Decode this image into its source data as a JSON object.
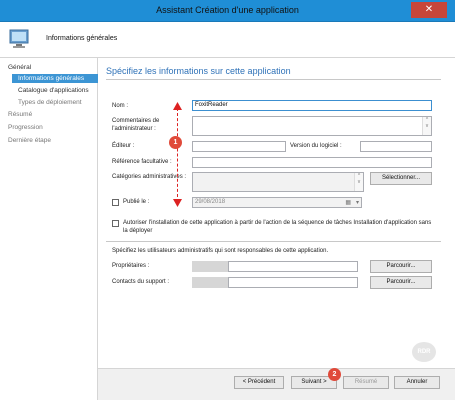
{
  "window": {
    "title": "Assistant Création d'une application",
    "close_label": "✕"
  },
  "header": {
    "title": "Informations générales"
  },
  "sidebar": {
    "items": [
      {
        "label": "Général"
      },
      {
        "label": "Informations générales"
      },
      {
        "label": "Catalogue d'applications"
      },
      {
        "label": "Types de déploiement"
      },
      {
        "label": "Résumé"
      },
      {
        "label": "Progression"
      },
      {
        "label": "Dernière étape"
      }
    ]
  },
  "main": {
    "title": "Spécifiez les informations sur cette application",
    "labels": {
      "name": "Nom :",
      "admin_comments": "Commentaires de l'administrateur :",
      "publisher": "Éditeur :",
      "software_version": "Version du logiciel :",
      "optional_reference": "Référence facultative :",
      "admin_categories": "Catégories administratives :",
      "published": "Publié le :",
      "allow_install": "Autoriser l'installation de cette application à partir de l'action de la séquence de tâches Installation d'application sans la déployer",
      "responsible_users": "Spécifiez les utilisateurs administratifs qui sont responsables de cette application.",
      "owners": "Propriétaires :",
      "support_contacts": "Contacts du support :"
    },
    "values": {
      "name": "FoxitReader",
      "admin_comments": "",
      "publisher": "",
      "software_version": "",
      "optional_reference": "",
      "admin_categories": "",
      "published_date": "29/08/2018"
    },
    "buttons": {
      "select": "Sélectionner...",
      "browse_owners": "Parcourir...",
      "browse_contacts": "Parcourir..."
    },
    "scroll": {
      "up": "^",
      "down": "v"
    },
    "icons": {
      "calendar": "▦",
      "dropdown": "▾"
    }
  },
  "footer": {
    "prev": "< Précédent",
    "next": "Suivant >",
    "summary": "Résumé",
    "cancel": "Annuler"
  },
  "annotations": {
    "badge1": "1",
    "badge2": "2",
    "watermark": "RDR"
  }
}
